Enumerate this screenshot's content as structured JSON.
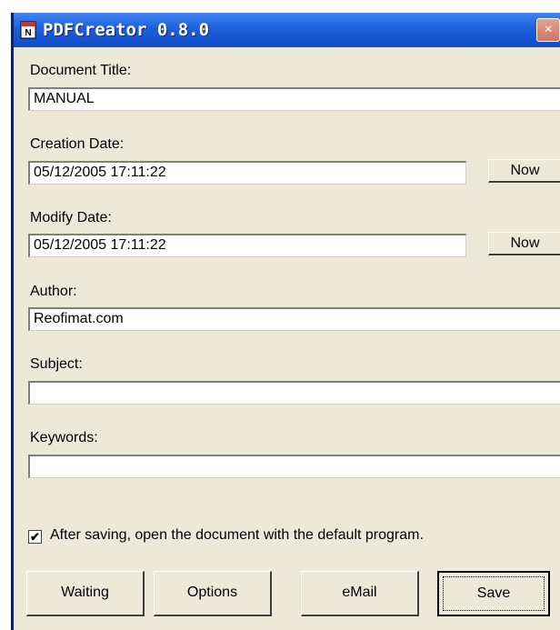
{
  "window": {
    "title": "PDFCreator 0.8.0",
    "close_symbol": "×",
    "app_icon": "pdfcreator-icon"
  },
  "form": {
    "document_title": {
      "label": "Document Title:",
      "value": "MANUAL"
    },
    "creation_date": {
      "label": "Creation Date:",
      "value": "05/12/2005 17:11:22",
      "now_label": "Now"
    },
    "modify_date": {
      "label": "Modify Date:",
      "value": "05/12/2005 17:11:22",
      "now_label": "Now"
    },
    "author": {
      "label": "Author:",
      "value": "Reofimat.com"
    },
    "subject": {
      "label": "Subject:",
      "value": ""
    },
    "keywords": {
      "label": "Keywords:",
      "value": ""
    }
  },
  "options": {
    "open_after_saving": {
      "label": "After saving, open the document with the default program.",
      "checked": true,
      "mark": "✔"
    }
  },
  "buttons": {
    "waiting": "Waiting",
    "options": "Options",
    "email": "eMail",
    "save": "Save"
  }
}
